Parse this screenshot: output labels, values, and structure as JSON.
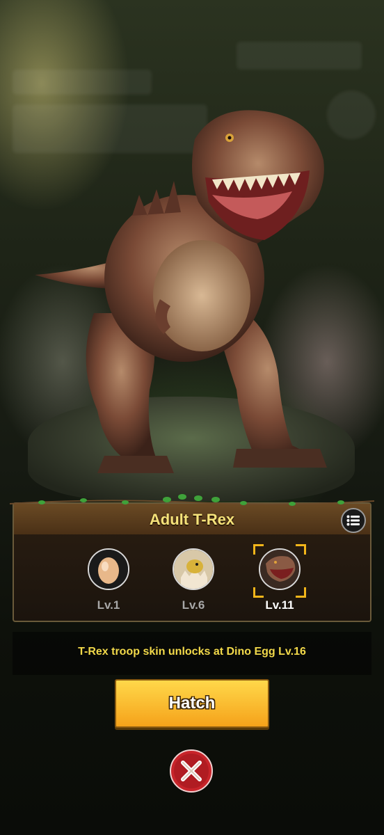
{
  "dino": {
    "stage_name": "Adult T-Rex",
    "stages": [
      {
        "label": "Lv.1",
        "icon": "egg-icon",
        "active": false
      },
      {
        "label": "Lv.6",
        "icon": "hatchling-icon",
        "active": false
      },
      {
        "label": "Lv.11",
        "icon": "adult-trex-icon",
        "active": true
      }
    ]
  },
  "description": "T-Rex troop skin unlocks at Dino Egg Lv.16",
  "actions": {
    "hatch_label": "Hatch",
    "close_icon": "close-icon",
    "list_icon": "list-icon"
  },
  "colors": {
    "title": "#f5e27a",
    "description": "#f2d94a",
    "hatch_button": "#f5a21a",
    "close_button": "#c8242a",
    "selection_bracket": "#f2b51a"
  }
}
